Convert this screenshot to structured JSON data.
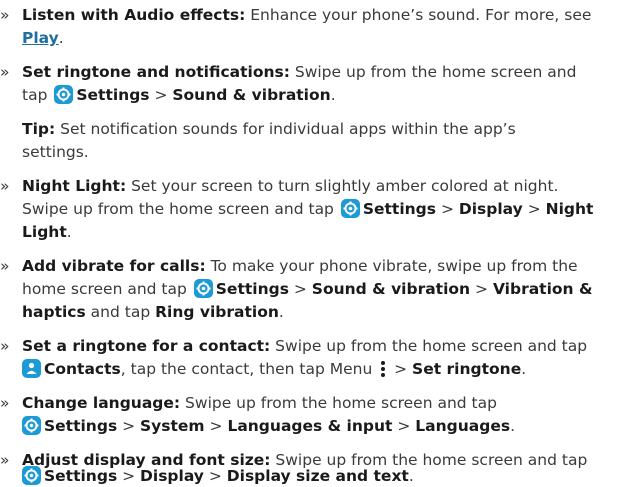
{
  "items": [
    {
      "title": "Listen with Audio effects:",
      "text": " Enhance your phone’s sound. For more, see",
      "link": "Play",
      "end": "."
    },
    {
      "title": "Set ringtone and notifications:",
      "l1": " Swipe up from the home screen and",
      "l2a": "tap",
      "b1": "Settings",
      "sep1": " > ",
      "b2": "Sound & vibration",
      "end": "."
    },
    {
      "tip_label": "Tip:",
      "tip1": " Set notification sounds for individual apps within the app’s",
      "tip2": "settings."
    },
    {
      "title": "Night Light:",
      "l1": " Set your screen to turn slightly amber colored at night.",
      "l2": "Swipe up from the home screen and tap",
      "b1": "Settings",
      "sep1": " > ",
      "b2": "Display",
      "sep2": " > ",
      "b3a": "Night",
      "b3b": "Light",
      "end": "."
    },
    {
      "title": "Add vibrate for calls:",
      "l1": " To make your phone vibrate, swipe up from the",
      "l2": "home screen and tap",
      "b1": "Settings",
      "sep1": " > ",
      "b2": "Sound & vibration",
      "sep2": " > ",
      "b3": "Vibration &",
      "b4": "haptics",
      "mid": " and tap ",
      "b5": "Ring vibration",
      "end": "."
    },
    {
      "title": "Set a ringtone for a contact:",
      "l1": " Swipe up from the home screen and tap",
      "b1": "Contacts",
      "mid": ", tap the contact, then tap Menu ",
      "sep": " > ",
      "b2": "Set ringtone",
      "end": "."
    },
    {
      "title": "Change language:",
      "l1": " Swipe up from the home screen and tap",
      "b1": "Settings",
      "sep1": " > ",
      "b2": "System",
      "sep2": " > ",
      "b3": "Languages & input",
      "sep3": " > ",
      "b4": "Languages",
      "end": "."
    },
    {
      "title": "Adjust display and font size:",
      "l1": " Swipe up from the home screen and tap",
      "b1": "Settings",
      "sep1": " > ",
      "b2": "Display",
      "sep2": " > ",
      "b3": "Display size and text",
      "end": "."
    }
  ],
  "bullet": "»",
  "icons": {
    "settings": "gear-icon",
    "contacts": "person-icon",
    "menu": "vertical-dots-icon"
  },
  "colors": {
    "icon_bg": "#1c9ad6",
    "link": "#1e6fa0"
  }
}
